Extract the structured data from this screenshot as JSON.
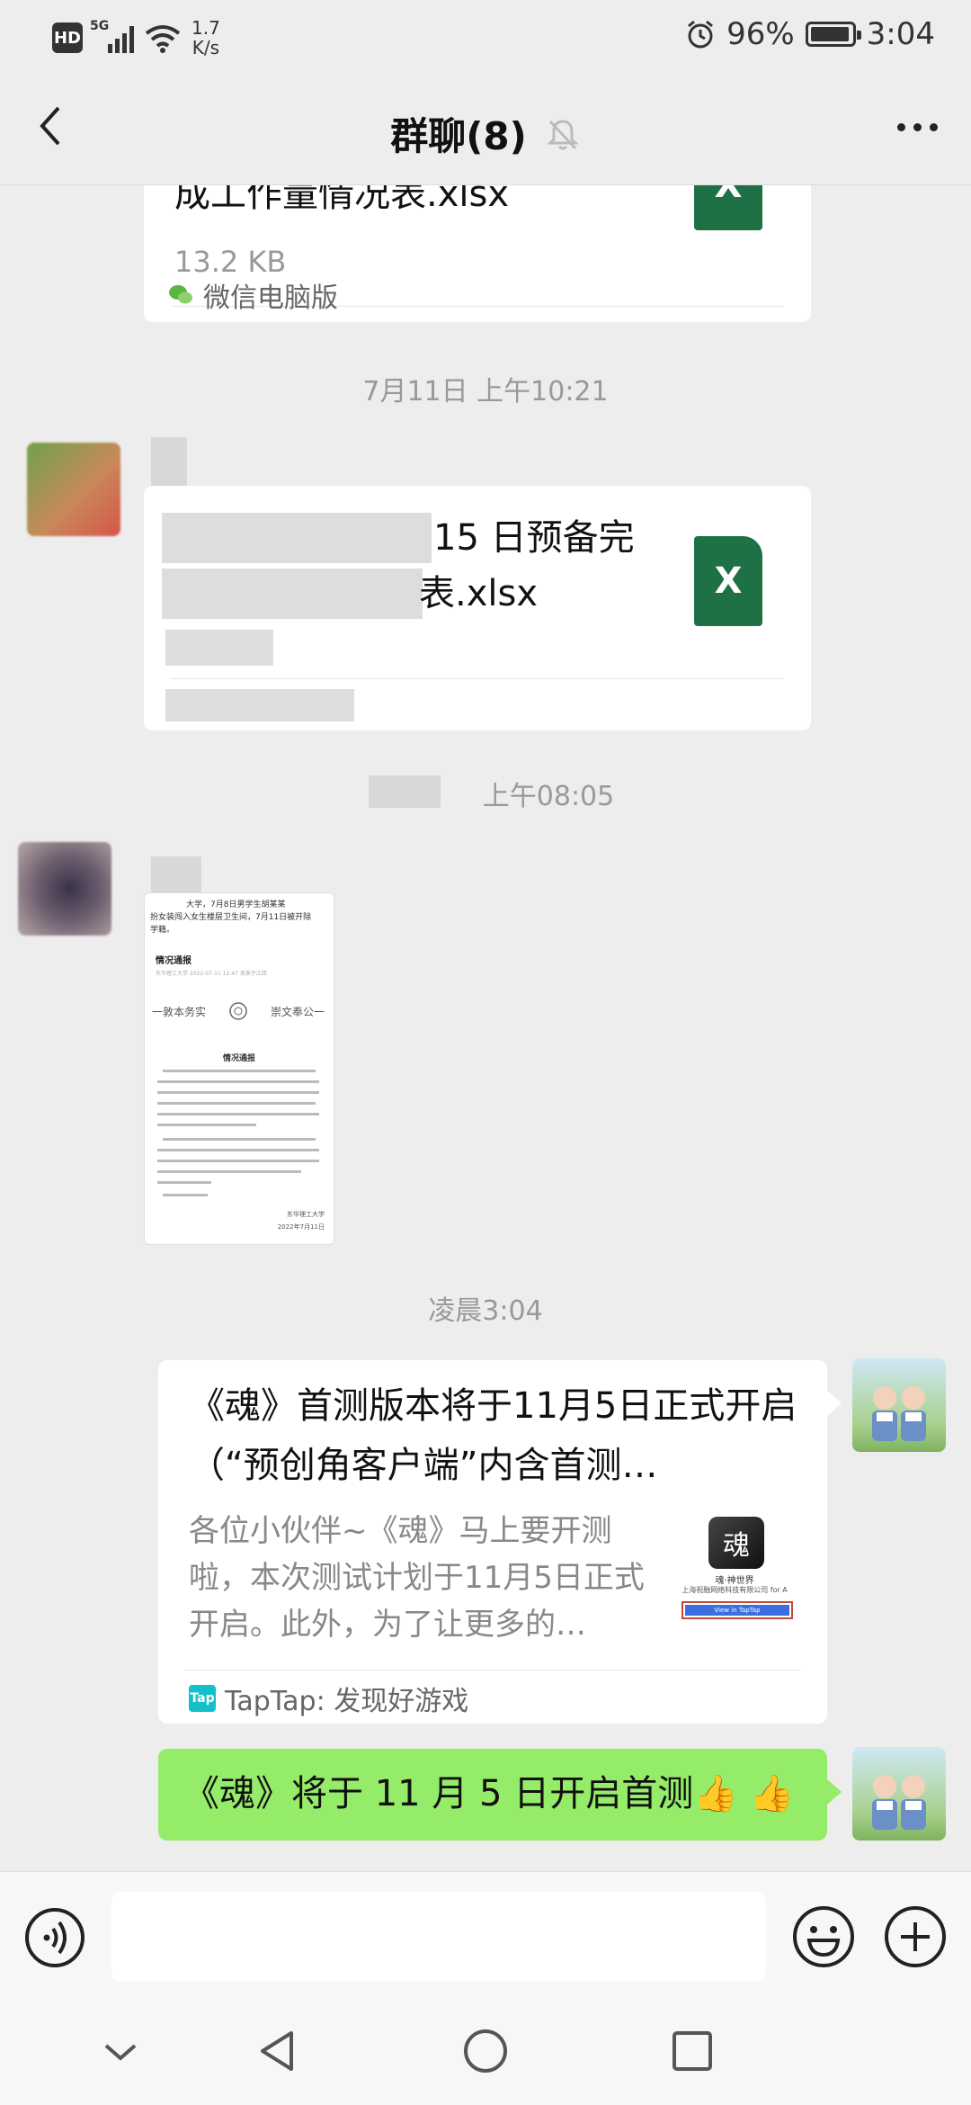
{
  "status_bar": {
    "hd": "HD",
    "network": "5G",
    "net_speed_value": "1.7",
    "net_speed_unit": "K/s",
    "battery_percent": "96%",
    "battery_level": 0.96,
    "time": "3:04"
  },
  "nav": {
    "title": "群聊(8)"
  },
  "messages": {
    "file1": {
      "name_partial": "成工作量情况表.xlsx",
      "size": "13.2 KB",
      "icon_label": "X",
      "source": "微信电脑版"
    },
    "time1": "7月11日 上午10:21",
    "file2": {
      "name_line1": "15 日预备完",
      "name_line2": "表.xlsx",
      "icon_label": "X"
    },
    "time2": "上午08:05",
    "doc_image": {
      "headline1": "大学，7月8日男学生胡某某",
      "headline2": "扮女装闯入女生楼层卫生间，7月11日被开除",
      "headline3": "学籍。",
      "section_title": "情况通报",
      "meta": "东华理工大学  2022-07-11 12:47  发表于江西",
      "motto_left": "一敦本务实",
      "motto_right": "崇文奉公一",
      "notice_title": "情况通报",
      "signature": "东华理工大学",
      "date": "2022年7月11日"
    },
    "time3": "凌晨3:04",
    "link_card": {
      "title": "《魂》首测版本将于11月5日正式开启（“预创角客户端”内含首测…",
      "description": "各位小伙伴~《魂》马上要开测啦，本次测试计划于11月5日正式开启。此外，为了让更多的…",
      "thumb_caption1": "魂·神世界",
      "thumb_caption2": "上海祝融网络科技有限公司 for A",
      "thumb_button": "View in TapTap",
      "source_icon": "Tap",
      "source": "TapTap: 发现好游戏"
    },
    "text_message": "《魂》将于 11 月 5 日开启首测👍 👍"
  },
  "input": {
    "placeholder": ""
  },
  "colors": {
    "background": "#ededed",
    "bubble_self": "#95ec69",
    "excel_green": "#1e7145",
    "taptap": "#14c0c8"
  },
  "icons": [
    "back-icon",
    "mute-icon",
    "more-icon",
    "excel-icon",
    "wechat-pc-icon",
    "taptap-icon",
    "voice-icon",
    "emoji-icon",
    "plus-icon",
    "nav-back-icon",
    "nav-home-icon",
    "nav-recents-icon",
    "nav-hide-keyboard-icon"
  ]
}
